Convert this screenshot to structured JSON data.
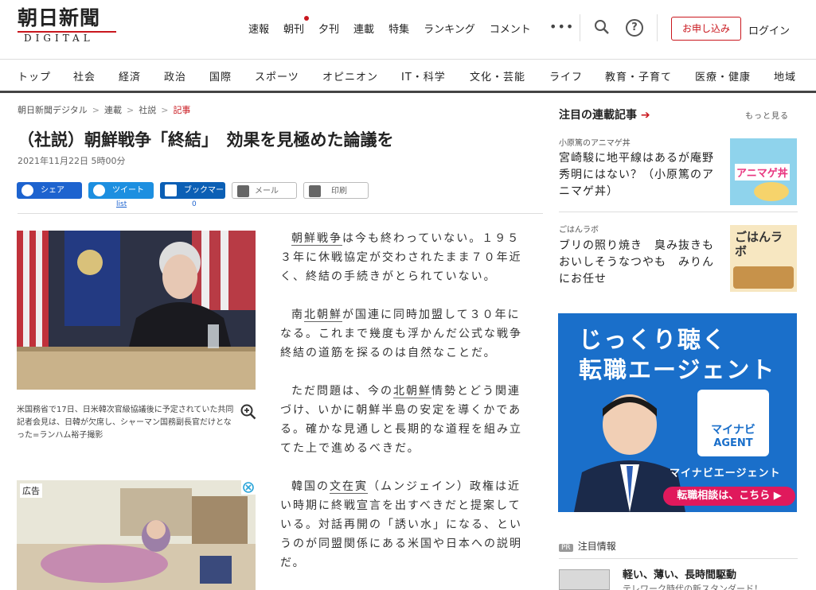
{
  "header": {
    "logo": "朝日新聞",
    "logo_sub": "DIGITAL",
    "nav": [
      "速報",
      "朝刊",
      "夕刊",
      "連載",
      "特集",
      "ランキング",
      "コメント"
    ],
    "more": "•••",
    "subscribe": "お申し込み",
    "login": "ログイン"
  },
  "categories": [
    "トップ",
    "社会",
    "経済",
    "政治",
    "国際",
    "スポーツ",
    "オピニオン",
    "IT・科学",
    "文化・芸能",
    "ライフ",
    "教育・子育て",
    "医療・健康",
    "地域"
  ],
  "breadcrumb": [
    "朝日新聞デジタル",
    "連載",
    "社説",
    "記事"
  ],
  "article": {
    "title": "（社説）朝鮮戦争「終結」　効果を見極めた論議を",
    "date": "2021年11月22日 5時00分",
    "share": {
      "facebook": "シェア",
      "twitter": "ツイート",
      "hatena": "ブックマーク",
      "mail": "メール",
      "print": "印刷",
      "twitter_count": "list",
      "hatena_count": "0"
    },
    "caption": "米国務省で17日、日米韓次官級協議後に予定されていた共同記者会見は、日韓が欠席し、シャーマン国務副長官だけとなった=ランハム裕子撮影",
    "ad_label": "広告",
    "paragraphs": [
      [
        "",
        "朝鮮戦争",
        "は今も終わっていない。１９５３年に休戦協定が交わされたまま７０年近く、終結の手続きがとられていない。"
      ],
      [
        "南",
        "北朝鮮",
        "が国連に同時加盟して３０年になる。これまで幾度も浮かんだ公式な戦争終結の道筋を探るのは自然なことだ。"
      ],
      [
        "ただ問題は、今の",
        "北朝鮮",
        "情勢とどう関連づけ、いかに朝鮮半島の安定を導くかである。確かな見通しと長期的な道程を組み立てた上で進めるべきだ。"
      ],
      [
        "韓国の",
        "文在寅",
        "（ムンジェイン）政権は近い時期に終戦宣言を出すべきだと提案している。対話再開の「誘い水」になる、というのが同盟関係にある米国や日本への説明だ。"
      ]
    ]
  },
  "sidebar": {
    "heading": "注目の連載記事",
    "more": "もっと見る",
    "items": [
      {
        "label": "小原篤のアニマゲ丼",
        "text": "宮崎駿に地平線はあるが庵野秀明にはない？（小原篤のアニマゲ丼）",
        "thumb": "アニマゲ丼"
      },
      {
        "label": "ごはんラボ",
        "text": "ブリの照り焼き　臭み抜きもおいしそうなつやも　みりんにお任せ",
        "thumb": "ごはんラボ"
      }
    ],
    "ad": {
      "line1": "じっくり聴く",
      "line2": "転職エージェント",
      "brand1": "マイナビ",
      "brand2": "AGENT",
      "agent": "マイナビエージェント",
      "cta": "転職相談は、こちら ▶"
    },
    "pr_badge": "PR",
    "pr_label": "注目情報",
    "pr_title": "軽い、薄い、長時間駆動",
    "pr_sub": "テレワーク時代の新スタンダード！"
  },
  "colors": {
    "accent": "#c9171e",
    "facebook": "#1d63cf",
    "twitter": "#1d8fe0",
    "ad_blue": "#1a6fca",
    "cta_pink": "#e0195c"
  }
}
